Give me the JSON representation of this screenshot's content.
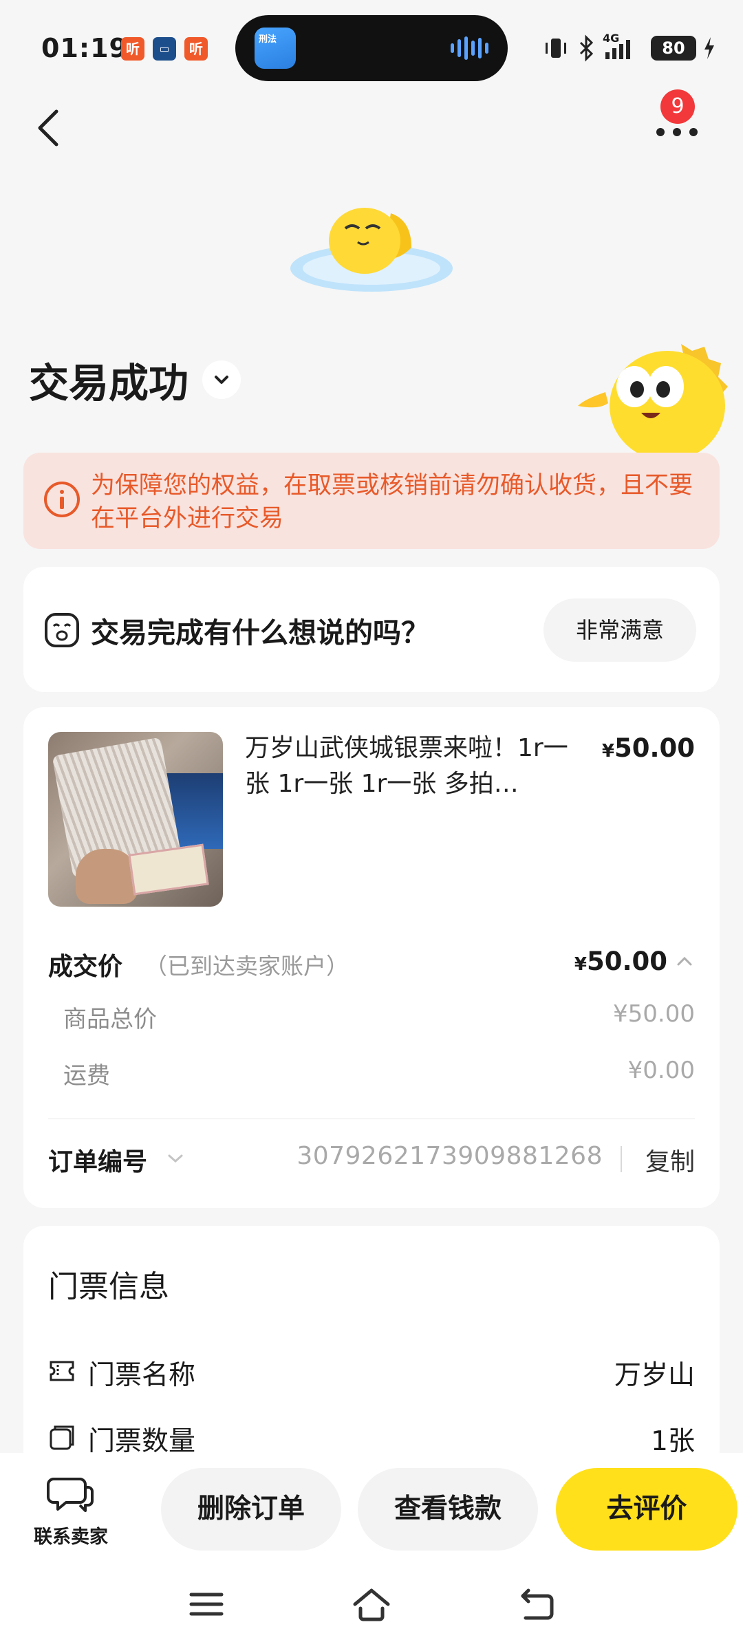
{
  "status_bar": {
    "time": "01:19",
    "app_icons": [
      "听",
      "▭",
      "听"
    ],
    "island_app_label": "刑法",
    "network": "4G",
    "battery": "80"
  },
  "header": {
    "notification_count": "9"
  },
  "status": {
    "title": "交易成功"
  },
  "warning": {
    "text": "为保障您的权益，在取票或核销前请勿确认收货，且不要在平台外进行交易"
  },
  "feedback": {
    "question": "交易完成有什么想说的吗？",
    "button": "非常满意"
  },
  "order": {
    "item_title": "万岁山武侠城银票来啦！1r一张 1r一张 1r一张 多拍…",
    "item_price_symbol": "¥",
    "item_price": "50.00",
    "deal_label": "成交价",
    "deal_note": "（已到达卖家账户）",
    "deal_price_symbol": "¥",
    "deal_price": "50.00",
    "subtotal_label": "商品总价",
    "subtotal_value": "¥50.00",
    "shipping_label": "运费",
    "shipping_value": "¥0.00",
    "order_no_label": "订单编号",
    "order_no": "3079262173909881268",
    "copy_label": "复制"
  },
  "ticket": {
    "heading": "门票信息",
    "name_label": "门票名称",
    "name_value": "万岁山",
    "qty_label": "门票数量",
    "qty_value": "1张"
  },
  "bottom": {
    "contact_label": "联系卖家",
    "delete_label": "删除订单",
    "view_money_label": "查看钱款",
    "review_label": "去评价"
  },
  "colors": {
    "accent_yellow": "#ffe01b",
    "warning_bg": "#f9e3df",
    "warning_text": "#e75a2a",
    "badge_red": "#f2383a"
  }
}
